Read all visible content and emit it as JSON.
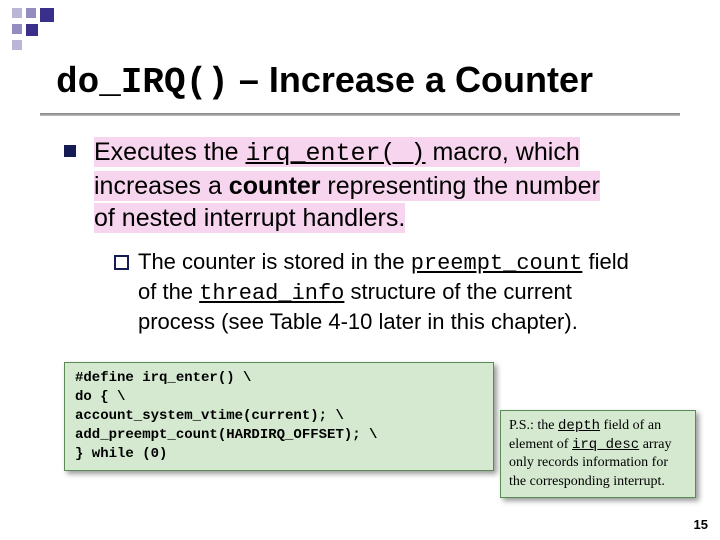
{
  "heading": {
    "code": "do_IRQ()",
    "rest": " – Increase a Counter"
  },
  "bullet": {
    "p1_prefix": "Executes the ",
    "p1_code": "irq_enter( )",
    "p1_mid": " macro, which",
    "p2_a": "increases a ",
    "p2_bold": "counter",
    "p2_b": " representing the number",
    "p3": "of nested interrupt handlers."
  },
  "sub": {
    "s1_a": "The counter is stored in the ",
    "s1_code": "preempt_count",
    "s1_b": " field",
    "s2_a": "of the ",
    "s2_code": "thread_info",
    "s2_b": " structure of the current",
    "s3": "process (see Table 4-10 later in this chapter)."
  },
  "code": {
    "l1": "#define irq_enter() \\",
    "l2": "do { \\",
    "l3": "account_system_vtime(current); \\",
    "l4": "add_preempt_count(HARDIRQ_OFFSET); \\",
    "l5": "} while (0)"
  },
  "ps": {
    "a": "P.S.: the ",
    "code1": "depth",
    "b": " field of an element of ",
    "code2": "irq_desc",
    "c": " array only records information for the corresponding interrupt."
  },
  "pagenum": "15"
}
